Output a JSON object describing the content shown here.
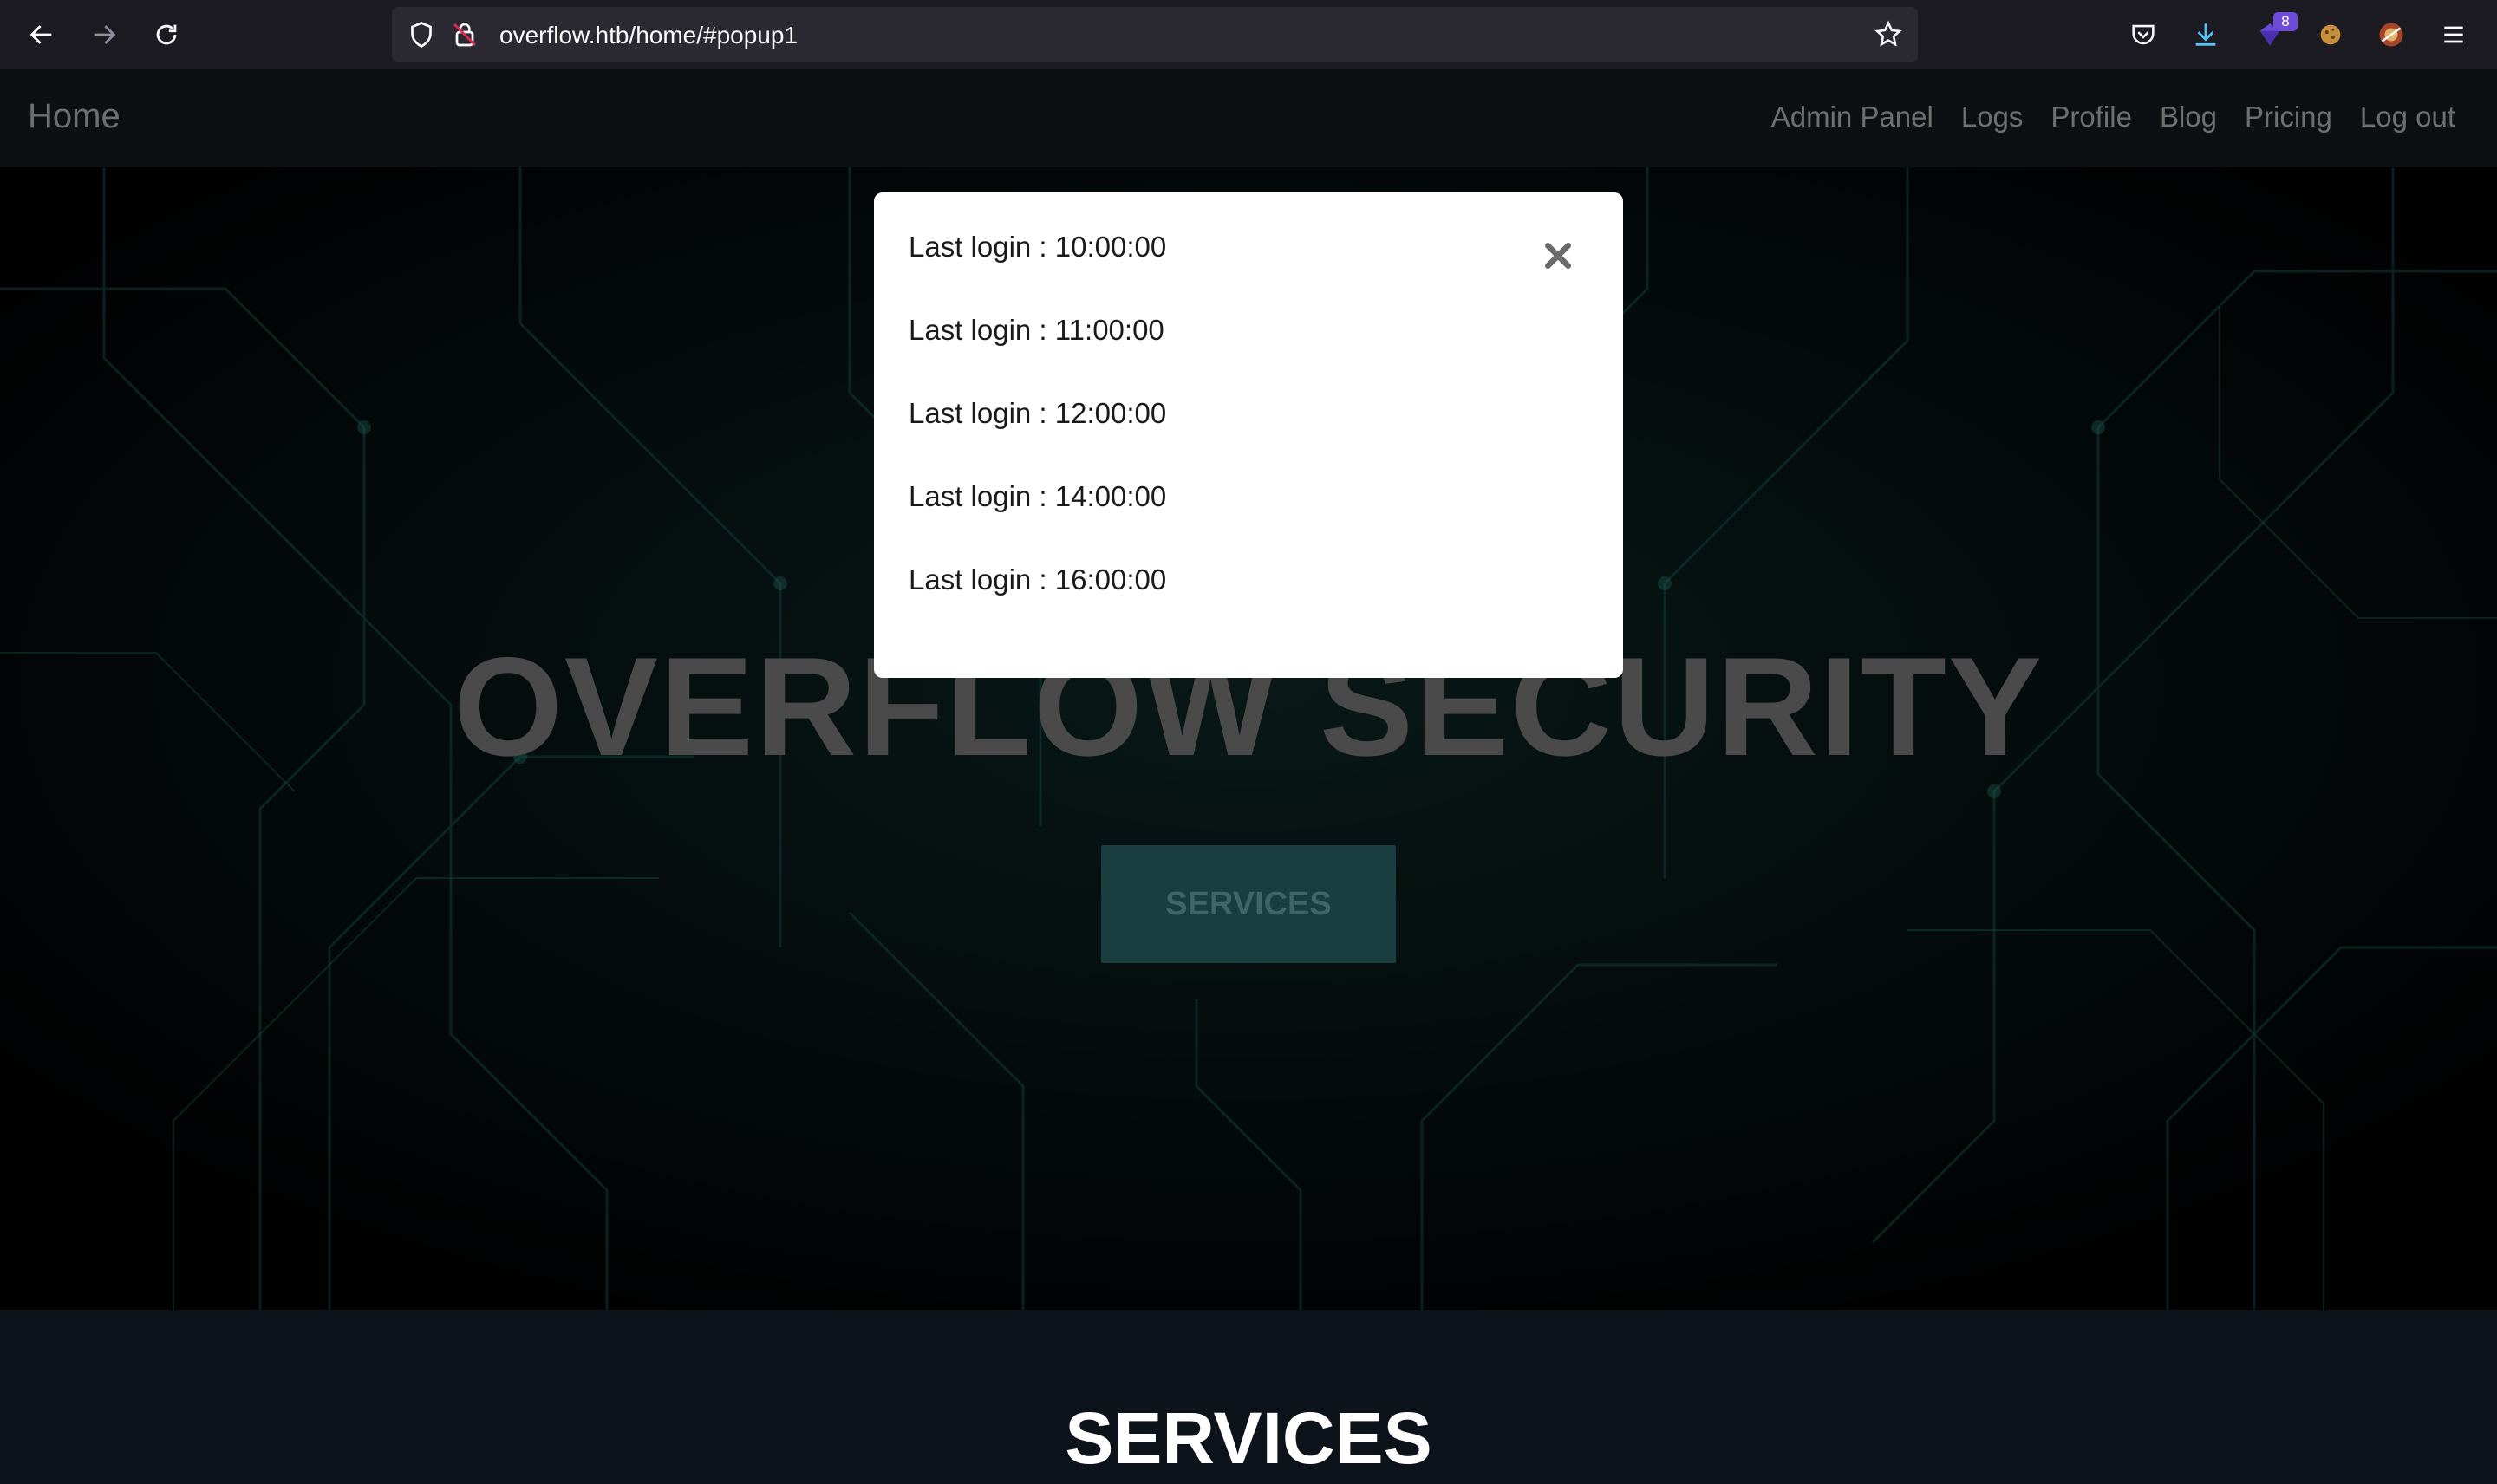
{
  "browser": {
    "url": "overflow.htb/home/#popup1",
    "extension_badge": "8",
    "icons": [
      "back-icon",
      "forward-icon",
      "reload-icon",
      "shield-icon",
      "insecure-lock-icon",
      "bookmark-star-icon",
      "pocket-icon",
      "download-icon",
      "extension-icon",
      "cookie-icon",
      "avatar-icon",
      "menu-icon"
    ]
  },
  "site": {
    "brand": "Home",
    "nav": [
      "Admin Panel",
      "Logs",
      "Profile",
      "Blog",
      "Pricing",
      "Log out"
    ]
  },
  "hero": {
    "title": "OVERFLOW SECURITY",
    "button": "SERVICES"
  },
  "services": {
    "heading": "SERVICES"
  },
  "popup": {
    "logins": [
      "Last login : 10:00:00",
      "Last login : 11:00:00",
      "Last login : 12:00:00",
      "Last login : 14:00:00",
      "Last login : 16:00:00"
    ]
  },
  "colors": {
    "chrome_bg": "#1c1b22",
    "urlbar_bg": "#2b2a33",
    "nav_bg": "#0d0f12",
    "hero_button": "#1a3d3f",
    "services_bg": "#0d131a",
    "circuit_line": "#1f6b63"
  }
}
